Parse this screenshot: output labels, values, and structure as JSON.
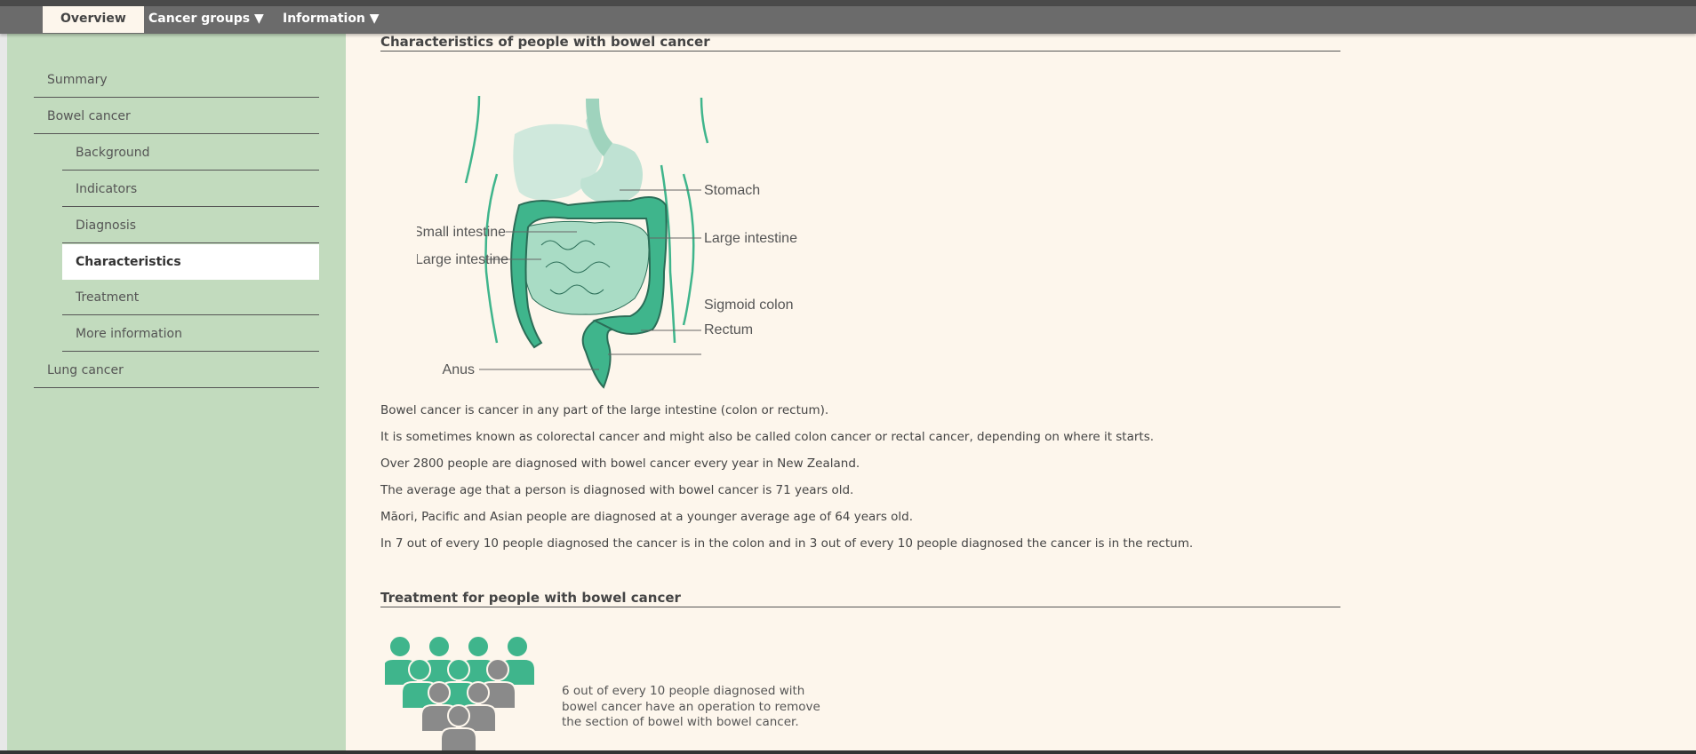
{
  "nav": {
    "tabs": [
      {
        "label": "Overview"
      },
      {
        "label": "Cancer groups ▼"
      },
      {
        "label": "Information ▼"
      }
    ]
  },
  "sidebar": {
    "items": [
      {
        "label": "Summary"
      },
      {
        "label": "Bowel cancer"
      },
      {
        "label": "Background"
      },
      {
        "label": "Indicators"
      },
      {
        "label": "Diagnosis"
      },
      {
        "label": "Characteristics"
      },
      {
        "label": "Treatment"
      },
      {
        "label": "More information"
      },
      {
        "label": "Lung cancer"
      }
    ]
  },
  "main": {
    "section1_title": "Characteristics of people with bowel cancer",
    "diagram_labels": {
      "stomach": "Stomach",
      "small_intestine": "Small intestine",
      "large_intestine_right": "Large intestine",
      "large_intestine_left": "Large intestine",
      "sigmoid_colon": "Sigmoid colon",
      "rectum": "Rectum",
      "anus": "Anus"
    },
    "paragraphs": [
      "Bowel cancer is cancer in any part of the large intestine (colon or rectum).",
      "It is sometimes known as colorectal cancer and might also be called colon cancer or rectal cancer, depending on where it starts.",
      "Over 2800 people are diagnosed with bowel cancer every year in New Zealand.",
      "The average age that a person is diagnosed with bowel cancer is 71 years old.",
      "Māori, Pacific and Asian people are diagnosed at a younger average age of 64 years old.",
      "In 7 out of every 10 people diagnosed the cancer is in the colon and in 3 out of every 10 people diagnosed the cancer is in the rectum."
    ],
    "section2_title": "Treatment for people with bowel cancer",
    "treatment_caption": "6 out of every 10 people diagnosed with bowel cancer have an operation to remove the section of bowel with bowel cancer."
  },
  "colors": {
    "sidebar_bg": "#c2dbbe",
    "page_bg": "#fdf6ec",
    "nav_bg": "#6b6b6b",
    "accent_green": "#3fb58c",
    "person_grey": "#8a8a8a"
  },
  "treatment_fraction": 0.6
}
